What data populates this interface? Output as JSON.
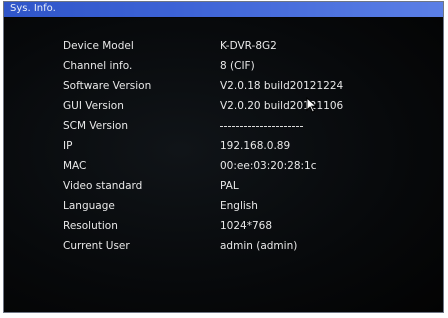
{
  "window": {
    "title": "Sys. Info."
  },
  "info": {
    "rows": [
      {
        "label": "Device Model",
        "value": "K-DVR-8G2"
      },
      {
        "label": "Channel info.",
        "value": "8 (CIF)"
      },
      {
        "label": "Software Version",
        "value": "V2.0.18 build20121224"
      },
      {
        "label": "GUI Version",
        "value": "V2.0.20 build20121106"
      },
      {
        "label": "SCM Version",
        "value": ""
      },
      {
        "label": "IP",
        "value": "192.168.0.89"
      },
      {
        "label": "MAC",
        "value": "00:ee:03:20:28:1c"
      },
      {
        "label": "Video standard",
        "value": "PAL"
      },
      {
        "label": "Language",
        "value": "English"
      },
      {
        "label": "Resolution",
        "value": "1024*768"
      },
      {
        "label": "Current User",
        "value": "admin (admin)"
      }
    ]
  },
  "colors": {
    "title_bar": "#3d63d6",
    "background": "#050505",
    "text": "#e9e9e9"
  },
  "icons": {
    "cursor": "mouse-pointer-icon"
  }
}
